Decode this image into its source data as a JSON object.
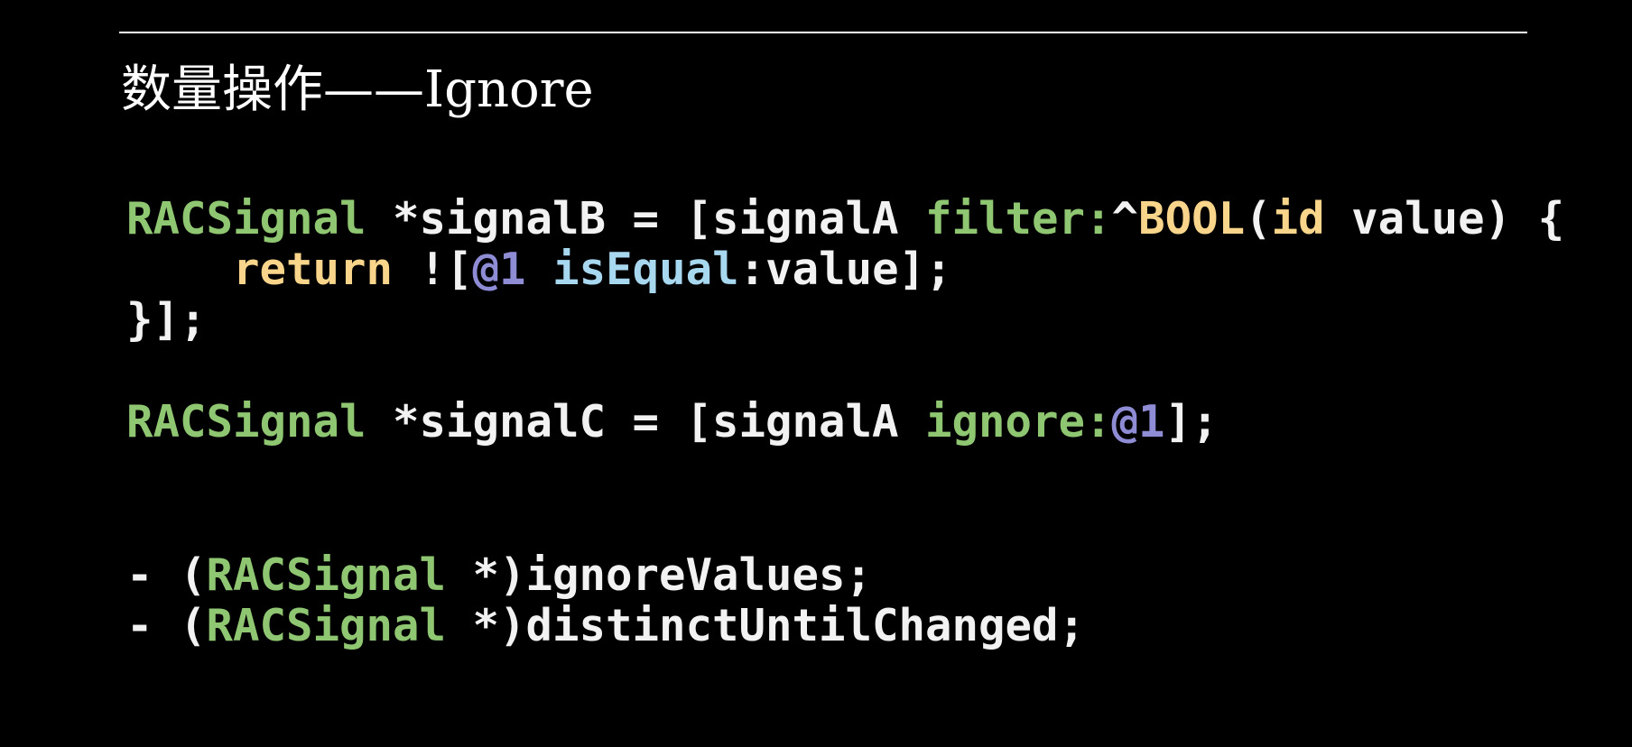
{
  "slide": {
    "title": "数量操作——Ignore"
  },
  "code": {
    "block1": [
      [
        {
          "text": "RACSignal",
          "role": "type"
        },
        {
          "text": " *signalB = [signalA ",
          "role": "plain"
        },
        {
          "text": "filter:",
          "role": "method"
        },
        {
          "text": "^",
          "role": "plain"
        },
        {
          "text": "BOOL",
          "role": "keyword"
        },
        {
          "text": "(",
          "role": "plain"
        },
        {
          "text": "id",
          "role": "keyword"
        },
        {
          "text": " value) {",
          "role": "plain"
        }
      ],
      [
        {
          "text": "return",
          "role": "keyword"
        },
        {
          "text": " ![",
          "role": "plain"
        },
        {
          "text": "@1",
          "role": "literal"
        },
        {
          "text": " ",
          "role": "plain"
        },
        {
          "text": "isEqual",
          "role": "call"
        },
        {
          "text": ":value];",
          "role": "plain"
        }
      ],
      [
        {
          "text": "}];",
          "role": "plain"
        }
      ]
    ],
    "block2": [
      [
        {
          "text": "RACSignal",
          "role": "type"
        },
        {
          "text": " *signalC = [signalA ",
          "role": "plain"
        },
        {
          "text": "ignore:",
          "role": "method"
        },
        {
          "text": "@1",
          "role": "literal"
        },
        {
          "text": "];",
          "role": "plain"
        }
      ]
    ],
    "block3": [
      [
        {
          "text": "- (",
          "role": "plain"
        },
        {
          "text": "RACSignal",
          "role": "type"
        },
        {
          "text": " *)ignoreValues;",
          "role": "plain"
        }
      ],
      [
        {
          "text": "- (",
          "role": "plain"
        },
        {
          "text": "RACSignal",
          "role": "type"
        },
        {
          "text": " *)distinctUntilChanged;",
          "role": "plain"
        }
      ]
    ]
  },
  "colors": {
    "background": "#000000",
    "plain": "#f2f2f2",
    "type": "#8fc671",
    "method": "#8fc671",
    "keyword": "#f9d58b",
    "literal": "#8f8cd6",
    "call": "#a8d8f0"
  }
}
